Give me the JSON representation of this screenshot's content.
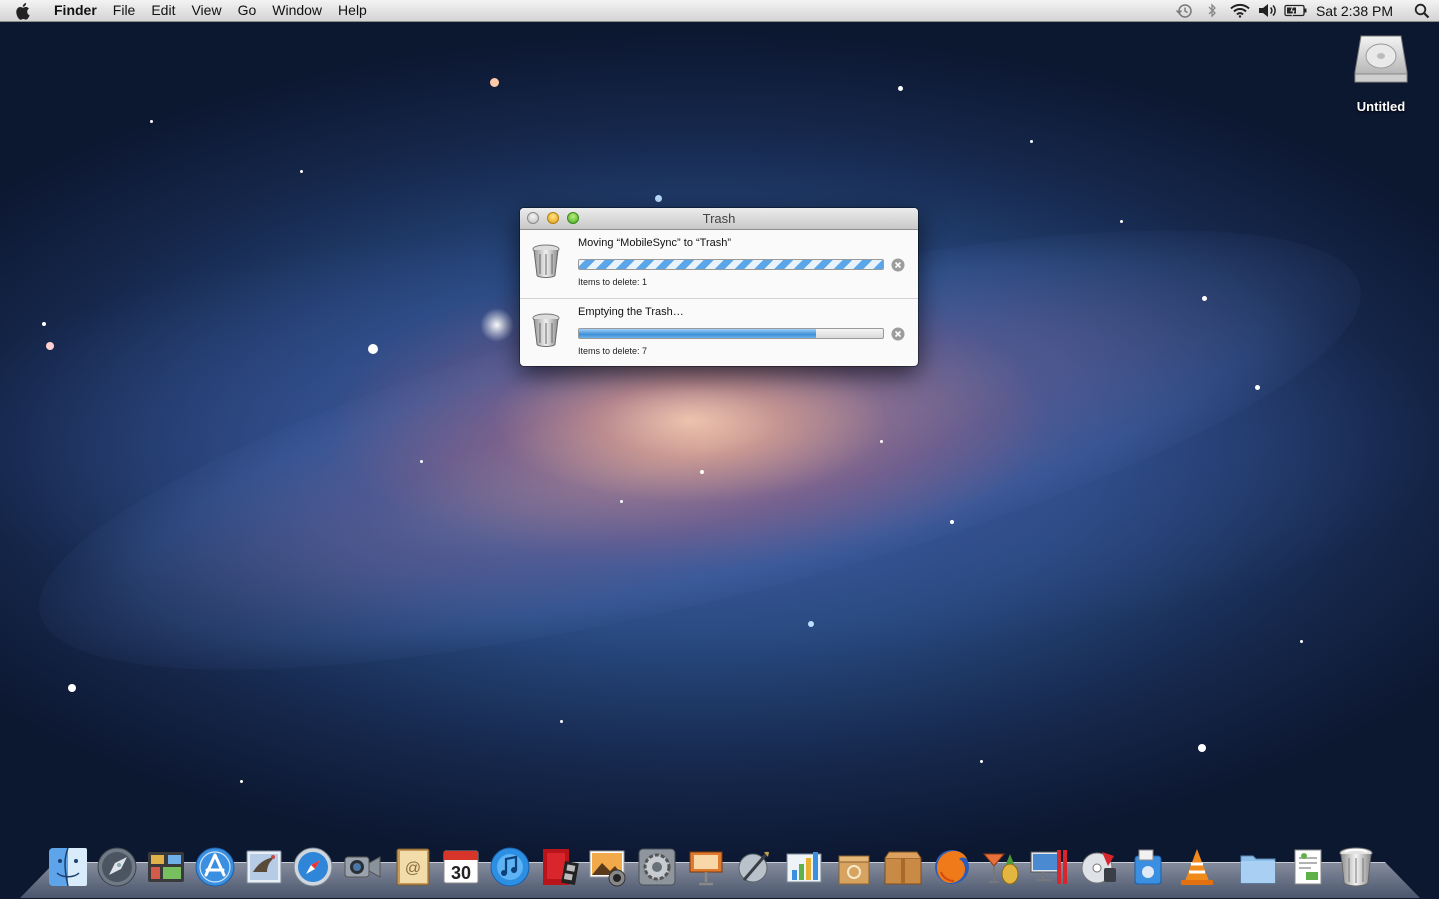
{
  "menubar": {
    "app_name": "Finder",
    "menus": [
      "File",
      "Edit",
      "View",
      "Go",
      "Window",
      "Help"
    ],
    "clock": "Sat 2:38 PM"
  },
  "desktop": {
    "drive_label": "Untitled"
  },
  "trash_window": {
    "title": "Trash",
    "operations": [
      {
        "title": "Moving “MobileSync” to “Trash”",
        "count": "Items to delete: 1",
        "progress": "indeterminate"
      },
      {
        "title": "Emptying the Trash…",
        "count": "Items to delete: 7",
        "progress": 0.78
      }
    ]
  },
  "dock": {
    "items": [
      "Finder",
      "Launchpad",
      "Mission Control",
      "App Store",
      "Mail",
      "Safari",
      "FaceTime",
      "Address Book",
      "iCal",
      "iTunes",
      "Photo Booth",
      "iPhoto",
      "System Preferences",
      "Keynote",
      "Script Editor",
      "Numbers",
      "Archive Utility",
      "Compress",
      "Firefox",
      "Cocktail",
      "Parallels Desktop",
      "DVD Player",
      "Applications",
      "VLC",
      "Documents",
      "Downloads",
      "Trash"
    ]
  },
  "colors": {
    "accent": "#3d8fd8",
    "menubar": "#e6e6e6",
    "window_bg": "#fafafa"
  }
}
